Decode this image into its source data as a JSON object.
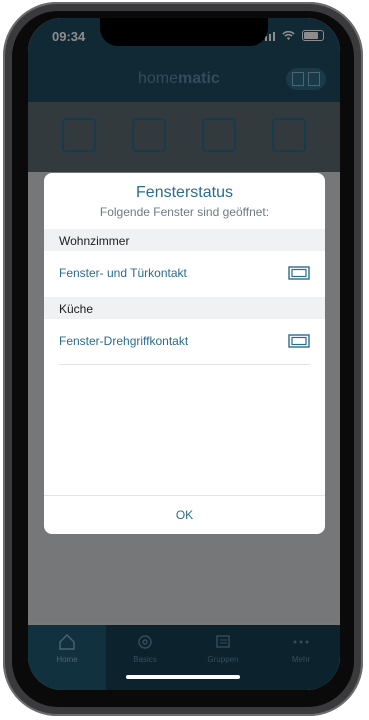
{
  "status_bar": {
    "time": "09:34"
  },
  "app": {
    "brand_light": "home",
    "brand_bold": "matic"
  },
  "dialog": {
    "title": "Fensterstatus",
    "subtitle": "Folgende Fenster sind geöffnet:",
    "sections": [
      {
        "label": "Wohnzimmer",
        "items": [
          {
            "label": "Fenster- und Türkontakt",
            "icon": "window-open-icon"
          }
        ]
      },
      {
        "label": "Küche",
        "items": [
          {
            "label": "Fenster-Drehgriffkontakt",
            "icon": "window-open-icon"
          }
        ]
      }
    ],
    "ok_label": "OK"
  },
  "tabbar": {
    "items": [
      {
        "label": "Home",
        "icon": "home-icon",
        "active": true
      },
      {
        "label": "Basics",
        "icon": "gear-icon",
        "active": false
      },
      {
        "label": "Gruppen",
        "icon": "groups-icon",
        "active": false
      },
      {
        "label": "Mehr",
        "icon": "more-icon",
        "active": false
      }
    ]
  },
  "colors": {
    "accent": "#2c6c8d",
    "header": "#1f4a61",
    "tabbar": "#163e52"
  }
}
